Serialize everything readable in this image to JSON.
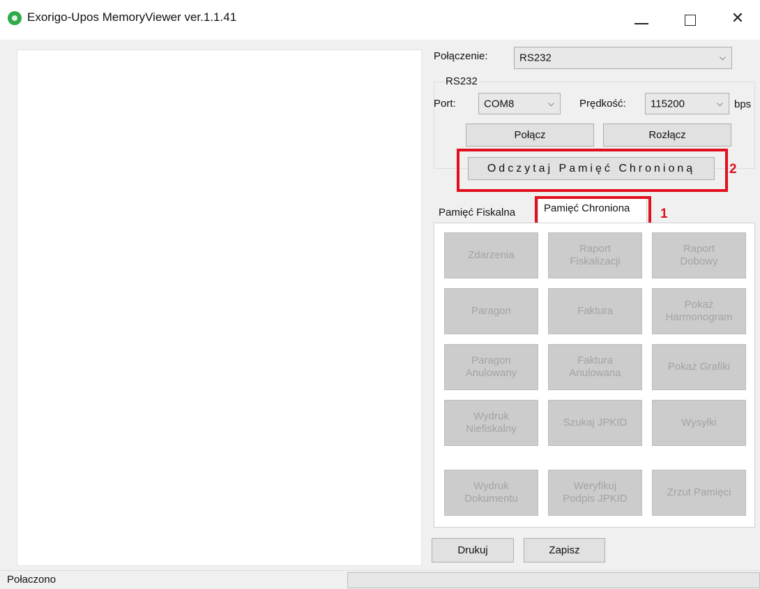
{
  "window": {
    "title": "Exorigo-Upos MemoryViewer ver.1.1.41",
    "minimize_glyph": "",
    "close_glyph": "✕"
  },
  "connection": {
    "label": "Połączenie:",
    "value": "RS232",
    "chevron": "⌵"
  },
  "rs232": {
    "group_title": "RS232",
    "port_label": "Port:",
    "port_value": "COM8",
    "speed_label": "Prędkość:",
    "speed_value": "115200",
    "unit": "bps",
    "connect_label": "Połącz",
    "disconnect_label": "Rozłącz",
    "read_label": "Odczytaj Pamięć Chronioną"
  },
  "annotations": {
    "box_tab_number": "1",
    "box_read_number": "2",
    "color": "#e0101e"
  },
  "tabs": [
    {
      "label": "Pamięć Fiskalna",
      "active": false
    },
    {
      "label": "Pamięć Chroniona",
      "active": true
    }
  ],
  "grid_buttons": [
    {
      "line1": "Zdarzenia",
      "line2": ""
    },
    {
      "line1": "Raport",
      "line2": "Fiskalizacji"
    },
    {
      "line1": "Raport",
      "line2": "Dobowy"
    },
    {
      "line1": "Paragon",
      "line2": ""
    },
    {
      "line1": "Faktura",
      "line2": ""
    },
    {
      "line1": "Pokaż",
      "line2": "Harmonogram"
    },
    {
      "line1": "Paragon",
      "line2": "Anulowany"
    },
    {
      "line1": "Faktura",
      "line2": "Anulowana"
    },
    {
      "line1": "Pokaż Grafiki",
      "line2": ""
    },
    {
      "line1": "Wydruk",
      "line2": "Niefiskalny"
    },
    {
      "line1": "Szukaj JPKID",
      "line2": ""
    },
    {
      "line1": "Wysyłki",
      "line2": ""
    },
    {
      "line1": "Wydruk",
      "line2": "Dokumentu"
    },
    {
      "line1": "Weryfikuj",
      "line2": "Podpis JPKID"
    },
    {
      "line1": "Zrzut Pamięci",
      "line2": ""
    }
  ],
  "bottom": {
    "print_label": "Drukuj",
    "save_label": "Zapisz"
  },
  "status": {
    "text": "Połaczono"
  },
  "colors": {
    "app_icon": "#2eaa48",
    "disabled_button": "#cccccc",
    "disabled_text": "#a3a3a3"
  }
}
